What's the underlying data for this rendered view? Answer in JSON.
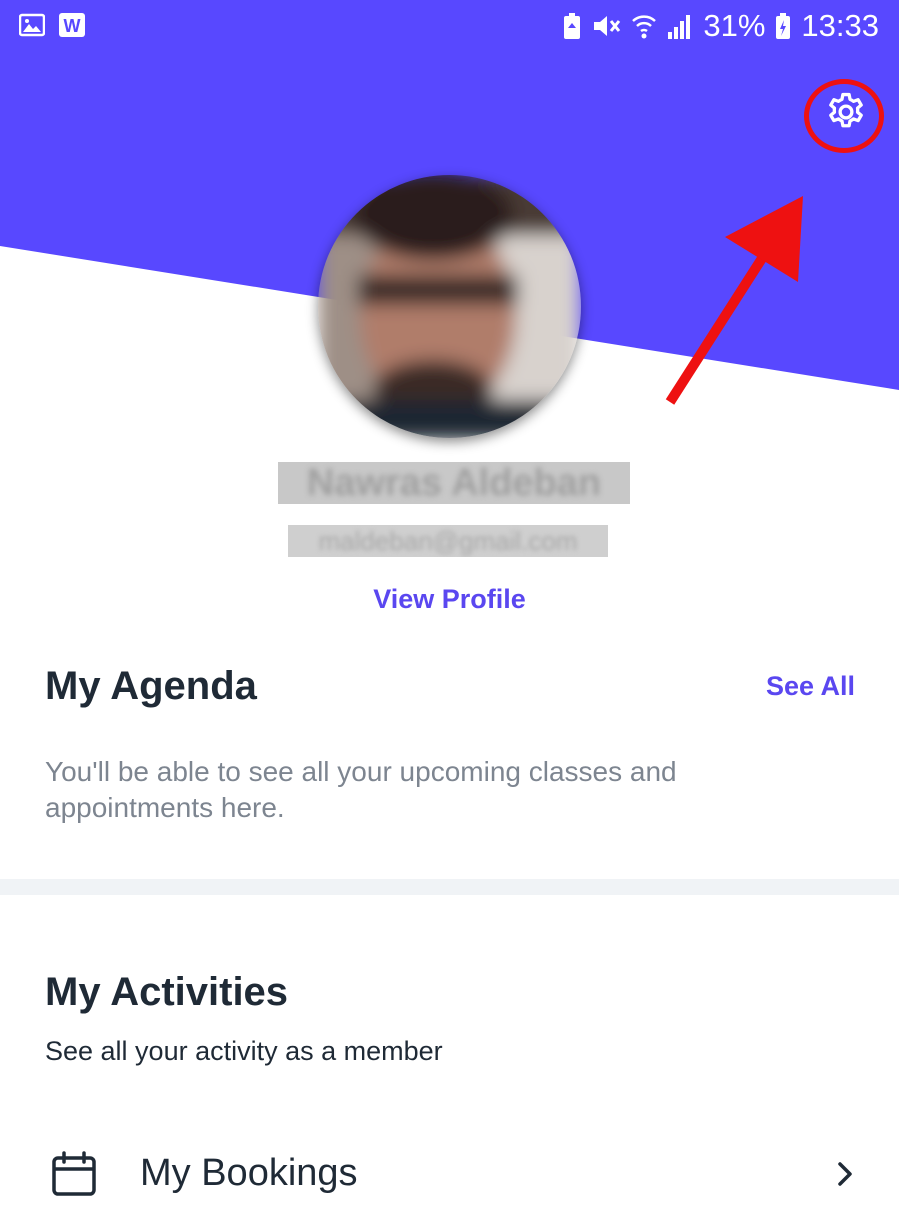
{
  "status_bar": {
    "left_icons": [
      "gallery-icon",
      "word-icon"
    ],
    "right_icons": [
      "battery-saver-icon",
      "vibrate-mute-icon",
      "wifi-icon",
      "signal-icon"
    ],
    "battery_percent": "31%",
    "time": "13:33"
  },
  "profile": {
    "name": "Nawras Aldeban",
    "email": "maldeban@gmail.com",
    "view_profile_label": "View Profile"
  },
  "agenda": {
    "title": "My Agenda",
    "see_all_label": "See All",
    "empty_message": "You'll be able to see all your upcoming classes and appointments here."
  },
  "activities": {
    "title": "My Activities",
    "subtitle": "See all your activity as a member",
    "items": [
      {
        "label": "My Bookings",
        "icon": "calendar-icon"
      }
    ]
  },
  "colors": {
    "brand": "#5a47f0",
    "header_bg": "#5848ff",
    "annotation": "#ee1111",
    "heading": "#1f2a36",
    "muted": "#7d8590"
  }
}
